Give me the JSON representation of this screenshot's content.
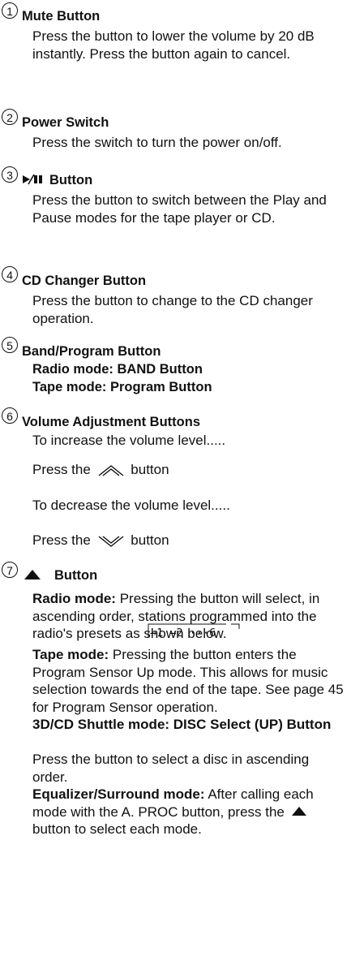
{
  "items": [
    {
      "num": "1",
      "title": "Mute Button",
      "body": "Press the button to lower the volume by 20 dB instantly. Press the button again to cancel."
    },
    {
      "num": "2",
      "title": "Power Switch",
      "body": "Press the switch to turn the power on/off."
    },
    {
      "num": "3",
      "title": "Button",
      "title_icon": "play-pause-icon",
      "body": "Press the button to switch between the Play and Pause modes for the tape player or CD."
    },
    {
      "num": "4",
      "title": "CD Changer Button",
      "body": "Press the button to change to the CD changer operation."
    },
    {
      "num": "5",
      "title": "Band/Program Button",
      "sub1": "Radio mode: BAND Button",
      "sub2": "Tape mode: Program Button"
    },
    {
      "num": "6",
      "title": "Volume Adjustment Buttons",
      "inc_text": "To increase the volume level.....",
      "press1_a": "Press the",
      "press1_b": "button",
      "press1_icon": "up-chevron-icon",
      "dec_text": "To decrease the volume level.....",
      "press2_a": "Press the",
      "press2_b": "button",
      "press2_icon": "down-chevron-icon"
    },
    {
      "num": "7",
      "title": "Button",
      "title_icon": "up-triangle-icon",
      "radio_label": "Radio mode:",
      "radio_text": "Pressing the button will select, in ascending order, stations programmed into the radio's presets as shown below.",
      "sequence": "→1 →2 ···6",
      "tape_label": "Tape mode:",
      "tape_text": "Pressing the button enters the Program Sensor Up mode. This allows for music selection towards the end of the tape. See page 45 for Program Sensor operation.",
      "shuttle_label": "3D/CD Shuttle mode: DISC Select (UP) Button",
      "shuttle_text": "Press the button to select a disc in ascending order.",
      "eq_label": "Equalizer/Surround mode:",
      "eq_text_a": "After calling each mode with the A. PROC button, press the",
      "eq_text_b": "button to select each mode."
    }
  ]
}
